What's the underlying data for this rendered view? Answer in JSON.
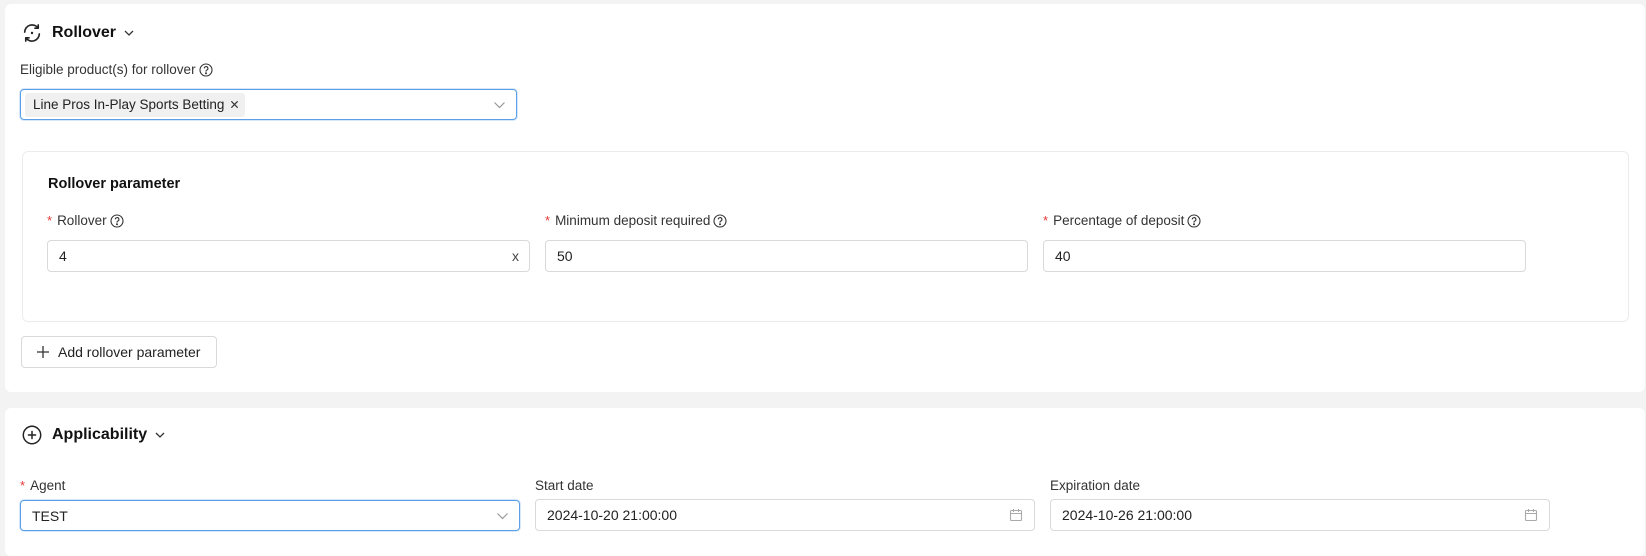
{
  "rollover_section": {
    "title": "Rollover",
    "eligible_label": "Eligible product(s) for rollover",
    "eligible_tags": [
      "Line Pros In-Play Sports Betting"
    ],
    "parameter_box": {
      "title": "Rollover parameter",
      "rollover_label": "Rollover",
      "rollover_value": "4",
      "rollover_suffix": "x",
      "min_deposit_label": "Minimum deposit required",
      "min_deposit_value": "50",
      "percentage_label": "Percentage of deposit",
      "percentage_value": "40"
    },
    "add_button_label": "Add rollover parameter"
  },
  "applicability_section": {
    "title": "Applicability",
    "agent_label": "Agent",
    "agent_value": "TEST",
    "start_date_label": "Start date",
    "start_date_value": "2024-10-20 21:00:00",
    "expiration_date_label": "Expiration date",
    "expiration_date_value": "2024-10-26 21:00:00"
  },
  "colors": {
    "required_marker": "#e53935",
    "focus_border": "#5aa0e6"
  },
  "icons": {
    "rollover": "rotate-arrows-icon",
    "applicability": "plus-circle-icon",
    "help": "question-circle-icon",
    "dropdown": "chevron-down-icon",
    "calendar": "calendar-icon",
    "tag_close": "close-icon",
    "add": "plus-icon"
  }
}
